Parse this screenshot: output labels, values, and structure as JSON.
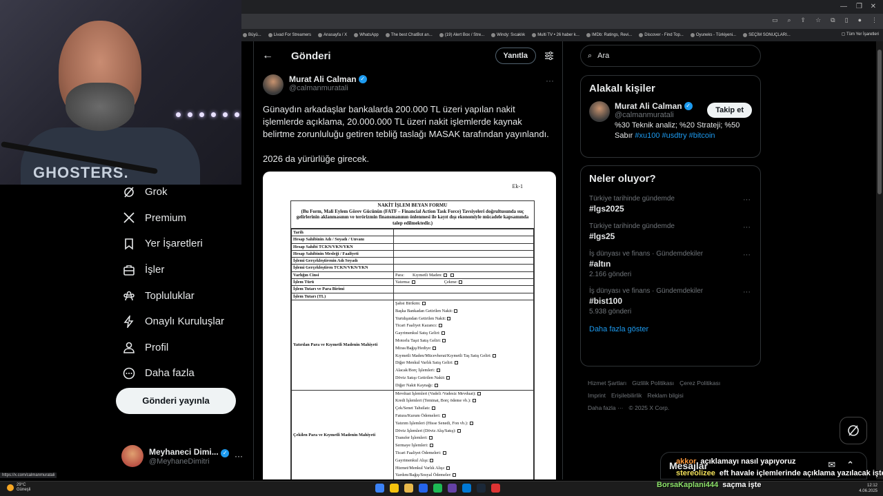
{
  "browser": {
    "bookmarks": [
      "Büyü...",
      "Livad For Streamers",
      "Anasayfa / X",
      "WhatsApp",
      "The best ChatBot an...",
      "(19) Alert Box / Stre...",
      "Windy: Sıcaklık",
      "Multi TV • 26 haber k...",
      "IMDb: Ratings, Revi...",
      "Discover - Find Top...",
      "Oyuneks - Türkiyeni...",
      "SEÇİM SONUÇLARI..."
    ],
    "all_bookmarks": "Tüm Yer İşaretleri"
  },
  "webcam": {
    "shirt_text": "GHOSTERS."
  },
  "nav": {
    "items": [
      {
        "label": "Grok",
        "icon": "grok-icon"
      },
      {
        "label": "Premium",
        "icon": "x-logo-icon"
      },
      {
        "label": "Yer İşaretleri",
        "icon": "bookmark-icon"
      },
      {
        "label": "İşler",
        "icon": "briefcase-icon"
      },
      {
        "label": "Topluluklar",
        "icon": "communities-icon"
      },
      {
        "label": "Onaylı Kuruluşlar",
        "icon": "lightning-icon"
      },
      {
        "label": "Profil",
        "icon": "profile-icon"
      },
      {
        "label": "Daha fazla",
        "icon": "more-circle-icon"
      }
    ],
    "post_button": "Gönderi yayınla",
    "account": {
      "name": "Meyhaneci Dimi...",
      "handle": "@MeyhaneDimitri"
    }
  },
  "status_url": "https://x.com/calmanmuratali",
  "main": {
    "title": "Gönderi",
    "reply_button": "Yanıtla",
    "author": {
      "name": "Murat Ali Calman",
      "handle": "@calmanmuratali"
    },
    "text_1": "Günaydın arkadaşlar bankalarda 200.000 TL üzeri yapılan nakit işlemlerde açıklama, 20.000.000 TL üzeri nakit işlemlerde kaynak belirtme zorunluluğu getiren tebliğ taslağı MASAK tarafından yayınlandı.",
    "text_2": "2026 da yürürlüğe girecek."
  },
  "doc": {
    "ek": "Ek-1",
    "title": "NAKİT İŞLEM BEYAN FORMU",
    "subtitle": "(Bu Form, Mali Eylem Görev Gücünün (FATF – Financial Action Task Force) Tavsiyeleri doğrultusunda suç gelirlerinin aklanmasının ve terörizmin finansmanının önlenmesi ile kayıt dışı ekonomiyle mücadele kapsamında talep edilmektedir.)",
    "rows": [
      "Tarih",
      "Hesap Sahibinin Adı / Soyadı / Unvanı",
      "Hesap Sahibi TCKN/VKN/YKN",
      "Hesap Sahibinin Mesleği / Faaliyeti",
      "İşlemi Gerçekleştirenin Adı Soyadı",
      "İşlemi Gerçekleştiren TCKN/VKN/YKN"
    ],
    "varlik_label": "Varlığın Cinsi",
    "varlik_opts": [
      "Para:",
      "Kıymetli Maden:"
    ],
    "islem_label": "İşlem Türü",
    "islem_opts": [
      "Yatırma:",
      "Çekme:"
    ],
    "tutar_label": "İşlem Tutarı ve Para Birimi",
    "tutar_tl_label": "İşlem Tutarı (TL)",
    "yatirilan_label": "Yatırılan Para ve Kıymetli Madenin Mahiyeti",
    "yatirilan_opts": [
      "Şahsi Birikim:",
      "Başka Bankadan Getirilen Nakit:",
      "Yurtdışından Getirilen Nakit:",
      "Ticari Faaliyet Kazancı:",
      "Gayrimenkul Satış Geliri:",
      "Motorlu Taşıt Satış Geliri:",
      "Miras/Bağış/Hediye:",
      "Kıymetli Maden/Mücevherat/Kıymetli Taş Satış Geliri:",
      "Diğer Menkul Varlık Satış Geliri:",
      "Alacak/Borç İşlemleri:",
      "Döviz Satışı Getirilen Nakit:",
      "Diğer Nakit Kaynağı:"
    ],
    "cekilen_label": "Çekilen Para ve Kıymetli Madenin Mahiyeti",
    "cekilen_opts": [
      "Mevduat İşlemleri (Vadeli /Vadesiz Mevduat):",
      "Kredi İşlemleri (Teminat, Borç ödeme vb.):",
      "Çek/Senet Tahsilatı:",
      "Fatura/Kurum Ödemeleri:",
      "Yatırım İşlemleri (Hisse Senedi, Fon vb.):",
      "Döviz İşlemleri (Döviz Alış/Satış):",
      "Transfer İşlemleri:",
      "Sermaye İşlemleri:",
      "Ticari Faaliyet Ödemeleri:",
      "Gayrimenkul Alışı:",
      "Hizmet/Menkul Varlık Alışı:",
      "Yardım/Bağış/Sosyal Ödemeler:"
    ]
  },
  "right": {
    "search_placeholder": "Ara",
    "related_title": "Alakalı kişiler",
    "person": {
      "name": "Murat Ali Calman",
      "handle": "@calmanmuratali",
      "bio": "%30 Teknik analiz; %20 Strateji; %50 Sabır",
      "tags": "#xu100 #usdtry #bitcoin",
      "follow": "Takip et"
    },
    "trends_title": "Neler oluyor?",
    "trends": [
      {
        "context": "Türkiye tarihinde gündemde",
        "tag": "#lgs2025",
        "count": ""
      },
      {
        "context": "Türkiye tarihinde gündemde",
        "tag": "#lgs25",
        "count": ""
      },
      {
        "context": "İş dünyası ve finans · Gündemdekiler",
        "tag": "#altın",
        "count": "2.166 gönderi"
      },
      {
        "context": "İş dünyası ve finans · Gündemdekiler",
        "tag": "#bist100",
        "count": "5.938 gönderi"
      }
    ],
    "show_more": "Daha fazla göster",
    "footer": [
      "Hizmet Şartları",
      "Gizlilik Politikası",
      "Çerez Politikası",
      "Imprint",
      "Erişilebilirlik",
      "Reklam bilgisi",
      "Daha fazla ···",
      "© 2025 X Corp."
    ]
  },
  "messages": {
    "label": "Mesajlar"
  },
  "chat": [
    {
      "user": "akkor",
      "msg": "açıklamayı nasıl yapıyoruz"
    },
    {
      "user": "stereolizee",
      "msg": "eft havale içlemlerinde açıklama yazılacak işte"
    },
    {
      "user": "BorsaKaplani444",
      "msg": "saçma işte"
    }
  ],
  "taskbar": {
    "temp": "29°C",
    "weather": "Güneşli",
    "time": "12:12",
    "date": "4.06.2025"
  }
}
